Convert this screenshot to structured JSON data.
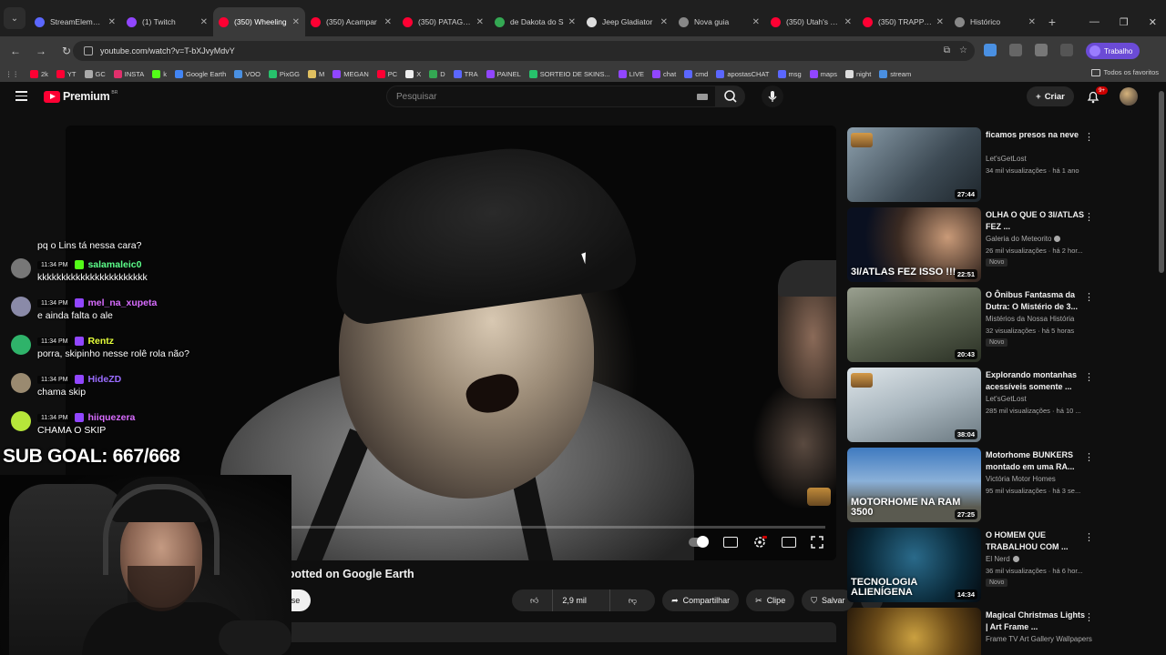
{
  "browser": {
    "tabs": [
      {
        "label": "StreamElements",
        "color": "#5b67ff"
      },
      {
        "label": "(1) Twitch",
        "color": "#9146ff"
      },
      {
        "label": "(350) Wheeling",
        "color": "#ff0033",
        "active": true
      },
      {
        "label": "(350) Acampar",
        "color": "#ff0033"
      },
      {
        "label": "(350) PATAGÔNIA",
        "color": "#ff0033"
      },
      {
        "label": "de Dakota do S",
        "color": "#34a853"
      },
      {
        "label": "Jeep Gladiator",
        "color": "#dddddd"
      },
      {
        "label": "Nova guia",
        "color": "#888888"
      },
      {
        "label": "(350) Utah's TOUGH",
        "color": "#ff0033"
      },
      {
        "label": "(350) TRAPPED",
        "color": "#ff0033"
      },
      {
        "label": "Histórico",
        "color": "#888888"
      }
    ],
    "url": "youtube.com/watch?v=T-bXJvyMdvY",
    "profile_label": "Trabalho",
    "bookmarks": [
      {
        "label": "2k",
        "color": "#ff0033"
      },
      {
        "label": "YT",
        "color": "#ff0033"
      },
      {
        "label": "GC",
        "color": "#aaaaaa"
      },
      {
        "label": "INSTA",
        "color": "#e1306c"
      },
      {
        "label": "k",
        "color": "#53fc18"
      },
      {
        "label": "Google Earth",
        "color": "#4285f4"
      },
      {
        "label": "VOO",
        "color": "#4a90e2"
      },
      {
        "label": "PixGG",
        "color": "#27c26c"
      },
      {
        "label": "M",
        "color": "#e0c060"
      },
      {
        "label": "MEGAN",
        "color": "#9146ff"
      },
      {
        "label": "PC",
        "color": "#ff0033"
      },
      {
        "label": "X",
        "color": "#eeeeee"
      },
      {
        "label": "D",
        "color": "#34a853"
      },
      {
        "label": "TRA",
        "color": "#5b67ff"
      },
      {
        "label": "PAINEL",
        "color": "#9146ff"
      },
      {
        "label": "SORTEIO DE SKINS...",
        "color": "#27c26c"
      },
      {
        "label": "LIVE",
        "color": "#9146ff"
      },
      {
        "label": "chat",
        "color": "#9146ff"
      },
      {
        "label": "cmd",
        "color": "#5b67ff"
      },
      {
        "label": "apostasCHAT",
        "color": "#5b67ff"
      },
      {
        "label": "msg",
        "color": "#5b67ff"
      },
      {
        "label": "maps",
        "color": "#9146ff"
      },
      {
        "label": "night",
        "color": "#dddddd"
      },
      {
        "label": "stream",
        "color": "#4a90e2"
      }
    ],
    "bookmarks_all": "Todos os favoritos"
  },
  "youtube": {
    "logo_word": "Premium",
    "logo_region": "BR",
    "search_placeholder": "Pesquisar",
    "create_label": "Criar",
    "notif_count": "9+",
    "video_title": "Find a Cabin I Spotted on Google Earth",
    "channel_tail": "o",
    "subscribe_label": "Inscrever-se",
    "likes": "2,9 mil",
    "share_label": "Compartilhar",
    "clip_label": "Clipe",
    "save_label": "Salvar"
  },
  "recommendations": [
    {
      "title": "ficamos presos na neve",
      "channel": "Let'sGetLost",
      "verified": false,
      "stats": "34 mil visualizações · há 1 ano",
      "duration": "27:44",
      "new": false,
      "overlay": "",
      "bg": "linear-gradient(135deg,#8da0ad,#3d4a54 60%,#1e262c)"
    },
    {
      "title": "OLHA O QUE O 3I/ATLAS FEZ ...",
      "channel": "Galeria do Meteorito",
      "verified": true,
      "stats": "26 mil visualizações · há 2 hor...",
      "duration": "22:51",
      "new": true,
      "overlay": "3I/ATLAS FEZ ISSO !!!",
      "bg": "radial-gradient(circle at 75% 40%,#c99a78,#3a2a22 45%,#0a1020 75%)"
    },
    {
      "title": "O Ônibus Fantasma da Dutra: O Mistério de 3...",
      "channel": "Mistérios da Nossa História",
      "verified": false,
      "stats": "32 visualizações · há 5 horas",
      "duration": "20:43",
      "new": true,
      "overlay": "",
      "bg": "linear-gradient(160deg,#9aa090,#5a6250 50%,#2a3024)"
    },
    {
      "title": "Explorando montanhas acessíveis somente ...",
      "channel": "Let'sGetLost",
      "verified": false,
      "stats": "285 mil visualizações · há 10 ...",
      "duration": "38:04",
      "new": false,
      "overlay": "",
      "bg": "linear-gradient(160deg,#dfe6ea,#a9b6be 50%,#6a7880)"
    },
    {
      "title": "Motorhome BUNKERS montado em uma RA...",
      "channel": "Victória Motor Homes",
      "verified": false,
      "stats": "95 mil visualizações · há 3 se...",
      "duration": "27:25",
      "new": false,
      "overlay": "MOTORHOME NA RAM 3500",
      "bg": "linear-gradient(180deg,#3f7ac0,#8ab0d8 45%,#5a5a50 80%)"
    },
    {
      "title": "O HOMEM QUE TRABALHOU COM ...",
      "channel": "El Nerd",
      "verified": true,
      "stats": "36 mil visualizações · há 6 hor...",
      "duration": "14:34",
      "new": true,
      "overlay": "TECNOLOGIA ALIENÍGENA",
      "bg": "radial-gradient(circle at 50% 40%,#2a6a8a,#0a2a3a 60%,#050a10)"
    },
    {
      "title": "Magical Christmas Lights | Art Frame ...",
      "channel": "Frame TV Art Gallery Wallpapers",
      "verified": false,
      "stats": "",
      "duration": "",
      "new": false,
      "overlay": "",
      "bg": "radial-gradient(circle at 50% 40%,#caa040,#6a4a18 50%,#1a1008)"
    }
  ],
  "new_label": "Novo",
  "chat": [
    {
      "time": "",
      "user": "",
      "user_color": "#ffffff",
      "text": "pq o Lins tá nessa cara?",
      "avatar": "",
      "badge": ""
    },
    {
      "time": "11:34 PM",
      "user": "salamaleic0",
      "user_color": "#5cff8a",
      "text": "kkkkkkkkkkkkkkkkkkkkkkk",
      "avatar": "#777777",
      "badge": "#53fc18"
    },
    {
      "time": "11:34 PM",
      "user": "mel_na_xupeta",
      "user_color": "#d86cff",
      "text": "e ainda falta o ale",
      "avatar": "#8a8aa8",
      "badge": "#9146ff"
    },
    {
      "time": "11:34 PM",
      "user": "Rentz",
      "user_color": "#e6ff3a",
      "text": "porra, skipinho nesse rolê rola não?",
      "avatar": "#2fb36a",
      "badge": "#9146ff"
    },
    {
      "time": "11:34 PM",
      "user": "HideZD",
      "user_color": "#9a6cff",
      "text": "chama skip",
      "avatar": "#9a8a70",
      "badge": "#9146ff"
    },
    {
      "time": "11:34 PM",
      "user": "hiiquezera",
      "user_color": "#d86cff",
      "text": "CHAMA O SKIP",
      "avatar": "#b6e63a",
      "badge": "#9146ff"
    }
  ],
  "sub_goal": "SUB GOAL: 667/668"
}
